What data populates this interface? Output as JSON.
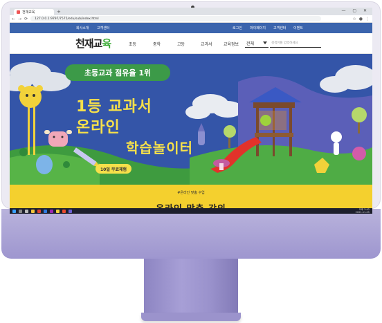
{
  "browser": {
    "tab_title": "천재교육",
    "new_tab": "+",
    "window_controls": "— ▢ ✕",
    "url": "127.0.0.1:9797/7575/edu/sub/index.html",
    "nav_back": "←",
    "nav_forward": "→",
    "nav_reload": "⟳"
  },
  "utilbar": {
    "links_left": [
      "회사소개",
      "고객센터"
    ],
    "links_right": [
      "로그인",
      "마이페이지",
      "고객센터",
      "이벤트"
    ]
  },
  "nav": {
    "logo_main": "천재교",
    "logo_accent": "육",
    "items": [
      "초등",
      "중학",
      "고등",
      "교과서",
      "교육정보"
    ],
    "select_value": "전체",
    "search_placeholder": "검색어를 입력하세요"
  },
  "hero": {
    "badge": "초등교과 점유율 1위",
    "title_line1": "1등 교과서",
    "title_line2": "온라인",
    "title_line3": "학습놀이터",
    "trial_button": "10일 무료체험"
  },
  "section2": {
    "kicker": "#온라인 맞춤 수업",
    "title": "온라인 맞춤 강의"
  },
  "taskbar": {
    "time": "오후 3:42",
    "date": "2021-11-05"
  },
  "colors": {
    "brand_blue": "#3b64ad",
    "hero_blue": "#3455a8",
    "accent_yellow": "#f6e04a",
    "badge_green": "#3c9a48",
    "imac_purple": "#a79fd6"
  },
  "icons": [
    "camera-icon",
    "back-icon",
    "forward-icon",
    "reload-icon",
    "dropdown-icon",
    "windows-start-icon"
  ]
}
